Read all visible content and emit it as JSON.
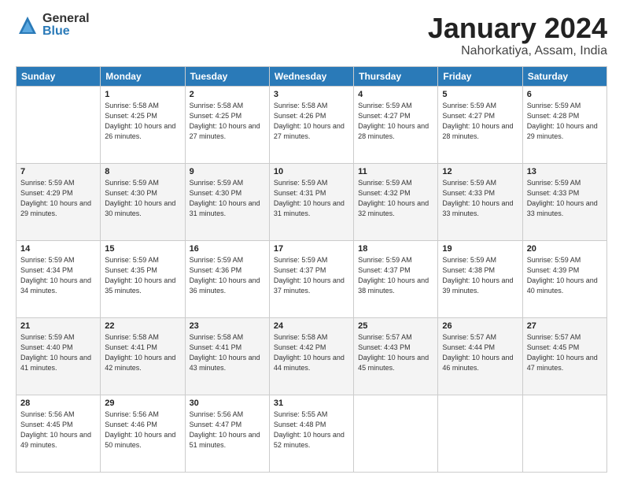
{
  "logo": {
    "general": "General",
    "blue": "Blue"
  },
  "title": "January 2024",
  "location": "Nahorkatiya, Assam, India",
  "headers": [
    "Sunday",
    "Monday",
    "Tuesday",
    "Wednesday",
    "Thursday",
    "Friday",
    "Saturday"
  ],
  "weeks": [
    [
      {
        "day": "",
        "sunrise": "",
        "sunset": "",
        "daylight": ""
      },
      {
        "day": "1",
        "sunrise": "Sunrise: 5:58 AM",
        "sunset": "Sunset: 4:25 PM",
        "daylight": "Daylight: 10 hours and 26 minutes."
      },
      {
        "day": "2",
        "sunrise": "Sunrise: 5:58 AM",
        "sunset": "Sunset: 4:25 PM",
        "daylight": "Daylight: 10 hours and 27 minutes."
      },
      {
        "day": "3",
        "sunrise": "Sunrise: 5:58 AM",
        "sunset": "Sunset: 4:26 PM",
        "daylight": "Daylight: 10 hours and 27 minutes."
      },
      {
        "day": "4",
        "sunrise": "Sunrise: 5:59 AM",
        "sunset": "Sunset: 4:27 PM",
        "daylight": "Daylight: 10 hours and 28 minutes."
      },
      {
        "day": "5",
        "sunrise": "Sunrise: 5:59 AM",
        "sunset": "Sunset: 4:27 PM",
        "daylight": "Daylight: 10 hours and 28 minutes."
      },
      {
        "day": "6",
        "sunrise": "Sunrise: 5:59 AM",
        "sunset": "Sunset: 4:28 PM",
        "daylight": "Daylight: 10 hours and 29 minutes."
      }
    ],
    [
      {
        "day": "7",
        "sunrise": "Sunrise: 5:59 AM",
        "sunset": "Sunset: 4:29 PM",
        "daylight": "Daylight: 10 hours and 29 minutes."
      },
      {
        "day": "8",
        "sunrise": "Sunrise: 5:59 AM",
        "sunset": "Sunset: 4:30 PM",
        "daylight": "Daylight: 10 hours and 30 minutes."
      },
      {
        "day": "9",
        "sunrise": "Sunrise: 5:59 AM",
        "sunset": "Sunset: 4:30 PM",
        "daylight": "Daylight: 10 hours and 31 minutes."
      },
      {
        "day": "10",
        "sunrise": "Sunrise: 5:59 AM",
        "sunset": "Sunset: 4:31 PM",
        "daylight": "Daylight: 10 hours and 31 minutes."
      },
      {
        "day": "11",
        "sunrise": "Sunrise: 5:59 AM",
        "sunset": "Sunset: 4:32 PM",
        "daylight": "Daylight: 10 hours and 32 minutes."
      },
      {
        "day": "12",
        "sunrise": "Sunrise: 5:59 AM",
        "sunset": "Sunset: 4:33 PM",
        "daylight": "Daylight: 10 hours and 33 minutes."
      },
      {
        "day": "13",
        "sunrise": "Sunrise: 5:59 AM",
        "sunset": "Sunset: 4:33 PM",
        "daylight": "Daylight: 10 hours and 33 minutes."
      }
    ],
    [
      {
        "day": "14",
        "sunrise": "Sunrise: 5:59 AM",
        "sunset": "Sunset: 4:34 PM",
        "daylight": "Daylight: 10 hours and 34 minutes."
      },
      {
        "day": "15",
        "sunrise": "Sunrise: 5:59 AM",
        "sunset": "Sunset: 4:35 PM",
        "daylight": "Daylight: 10 hours and 35 minutes."
      },
      {
        "day": "16",
        "sunrise": "Sunrise: 5:59 AM",
        "sunset": "Sunset: 4:36 PM",
        "daylight": "Daylight: 10 hours and 36 minutes."
      },
      {
        "day": "17",
        "sunrise": "Sunrise: 5:59 AM",
        "sunset": "Sunset: 4:37 PM",
        "daylight": "Daylight: 10 hours and 37 minutes."
      },
      {
        "day": "18",
        "sunrise": "Sunrise: 5:59 AM",
        "sunset": "Sunset: 4:37 PM",
        "daylight": "Daylight: 10 hours and 38 minutes."
      },
      {
        "day": "19",
        "sunrise": "Sunrise: 5:59 AM",
        "sunset": "Sunset: 4:38 PM",
        "daylight": "Daylight: 10 hours and 39 minutes."
      },
      {
        "day": "20",
        "sunrise": "Sunrise: 5:59 AM",
        "sunset": "Sunset: 4:39 PM",
        "daylight": "Daylight: 10 hours and 40 minutes."
      }
    ],
    [
      {
        "day": "21",
        "sunrise": "Sunrise: 5:59 AM",
        "sunset": "Sunset: 4:40 PM",
        "daylight": "Daylight: 10 hours and 41 minutes."
      },
      {
        "day": "22",
        "sunrise": "Sunrise: 5:58 AM",
        "sunset": "Sunset: 4:41 PM",
        "daylight": "Daylight: 10 hours and 42 minutes."
      },
      {
        "day": "23",
        "sunrise": "Sunrise: 5:58 AM",
        "sunset": "Sunset: 4:41 PM",
        "daylight": "Daylight: 10 hours and 43 minutes."
      },
      {
        "day": "24",
        "sunrise": "Sunrise: 5:58 AM",
        "sunset": "Sunset: 4:42 PM",
        "daylight": "Daylight: 10 hours and 44 minutes."
      },
      {
        "day": "25",
        "sunrise": "Sunrise: 5:57 AM",
        "sunset": "Sunset: 4:43 PM",
        "daylight": "Daylight: 10 hours and 45 minutes."
      },
      {
        "day": "26",
        "sunrise": "Sunrise: 5:57 AM",
        "sunset": "Sunset: 4:44 PM",
        "daylight": "Daylight: 10 hours and 46 minutes."
      },
      {
        "day": "27",
        "sunrise": "Sunrise: 5:57 AM",
        "sunset": "Sunset: 4:45 PM",
        "daylight": "Daylight: 10 hours and 47 minutes."
      }
    ],
    [
      {
        "day": "28",
        "sunrise": "Sunrise: 5:56 AM",
        "sunset": "Sunset: 4:45 PM",
        "daylight": "Daylight: 10 hours and 49 minutes."
      },
      {
        "day": "29",
        "sunrise": "Sunrise: 5:56 AM",
        "sunset": "Sunset: 4:46 PM",
        "daylight": "Daylight: 10 hours and 50 minutes."
      },
      {
        "day": "30",
        "sunrise": "Sunrise: 5:56 AM",
        "sunset": "Sunset: 4:47 PM",
        "daylight": "Daylight: 10 hours and 51 minutes."
      },
      {
        "day": "31",
        "sunrise": "Sunrise: 5:55 AM",
        "sunset": "Sunset: 4:48 PM",
        "daylight": "Daylight: 10 hours and 52 minutes."
      },
      {
        "day": "",
        "sunrise": "",
        "sunset": "",
        "daylight": ""
      },
      {
        "day": "",
        "sunrise": "",
        "sunset": "",
        "daylight": ""
      },
      {
        "day": "",
        "sunrise": "",
        "sunset": "",
        "daylight": ""
      }
    ]
  ]
}
